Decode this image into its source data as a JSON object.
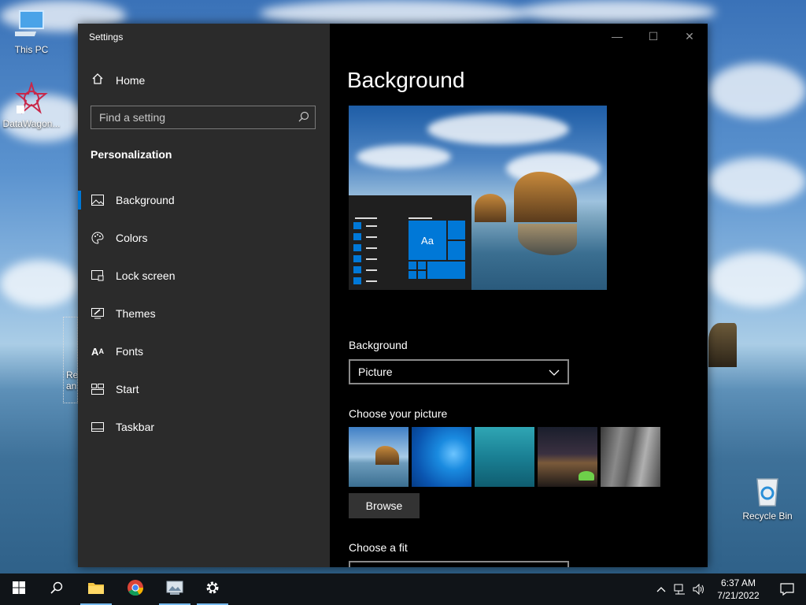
{
  "desktop": {
    "icons": [
      {
        "label": "This PC"
      },
      {
        "label": "DataWagon..."
      },
      {
        "label": "Recycle Bin"
      }
    ],
    "partial_icon_text": "Re\nan"
  },
  "window": {
    "title": "Settings",
    "controls": {
      "minimize": "—",
      "maximize": "☐",
      "close": "✕"
    }
  },
  "sidebar": {
    "home_label": "Home",
    "search_placeholder": "Find a setting",
    "section": "Personalization",
    "items": [
      {
        "label": "Background",
        "icon": "picture-icon",
        "active": true
      },
      {
        "label": "Colors",
        "icon": "palette-icon"
      },
      {
        "label": "Lock screen",
        "icon": "lock-screen-icon"
      },
      {
        "label": "Themes",
        "icon": "themes-icon"
      },
      {
        "label": "Fonts",
        "icon": "fonts-icon"
      },
      {
        "label": "Start",
        "icon": "start-icon"
      },
      {
        "label": "Taskbar",
        "icon": "taskbar-icon"
      }
    ]
  },
  "main": {
    "title": "Background",
    "preview_tile_text": "Aa",
    "background_label": "Background",
    "background_value": "Picture",
    "choose_picture_label": "Choose your picture",
    "browse_label": "Browse",
    "choose_fit_label": "Choose a fit"
  },
  "taskbar": {
    "time": "6:37 AM",
    "date": "7/21/2022"
  },
  "colors": {
    "accent": "#0078d7",
    "sidebar_bg": "#2b2b2b",
    "content_bg": "#000000",
    "taskbar_bg": "#101418"
  }
}
